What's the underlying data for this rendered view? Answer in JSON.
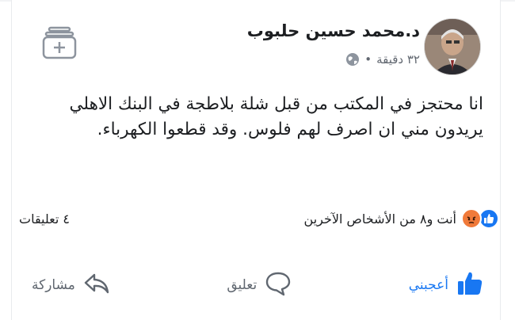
{
  "post": {
    "author": "د.محمد حسين حلبوب",
    "time": "٣٢ دقيقة",
    "separator": "•",
    "text": "انا محتجز في المكتب من قبل شلة بلاطجة في البنك الاهلي يريدون مني ان اصرف لهم فلوس. وقد قطعوا الكهرباء."
  },
  "reactions": {
    "summary": "أنت و٨ من الأشخاص الآخرين",
    "comments": "٤ تعليقات",
    "icons": [
      "like-icon",
      "angry-icon"
    ]
  },
  "actions": {
    "like": "أعجبني",
    "comment": "تعليق",
    "share": "مشاركة"
  },
  "colors": {
    "accent": "#1877f2",
    "angry": "#f07a3a",
    "muted": "#606770"
  }
}
